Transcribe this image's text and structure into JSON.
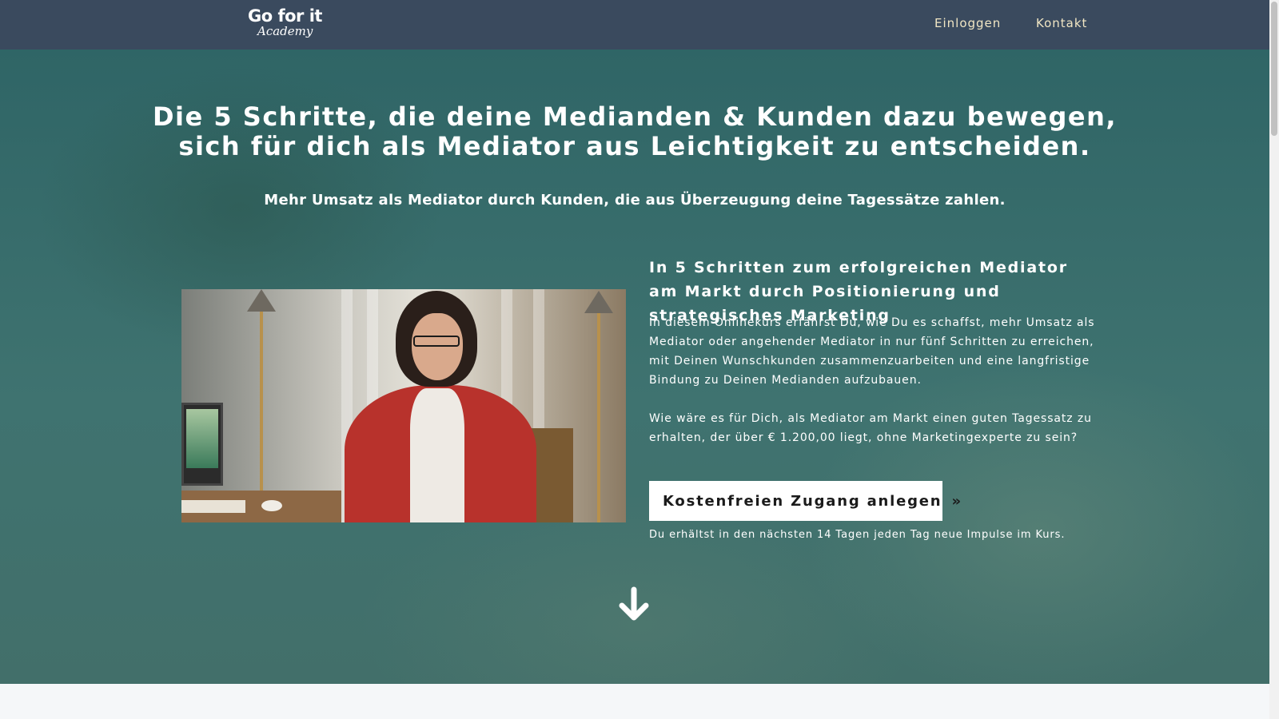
{
  "nav": {
    "logo_main": "Go for it",
    "logo_sub": "Academy",
    "links": [
      {
        "label": "Einloggen"
      },
      {
        "label": "Kontakt"
      }
    ]
  },
  "hero": {
    "headline": "Die 5 Schritte, die deine Medianden & Kunden dazu bewegen, sich für dich als Mediator aus Leichtigkeit zu entscheiden.",
    "subheadline": "Mehr Umsatz als Mediator durch Kunden, die aus Überzeugung deine Tagessätze zahlen."
  },
  "course": {
    "title": "In 5 Schritten zum erfolgreichen Mediator am Markt durch Positionierung und strategisches Marketing",
    "paragraph_1": "In diesem Onlinekurs erfährst Du, wie Du es schaffst, mehr Umsatz als Mediator oder angehender Mediator in nur fünf Schritten zu erreichen, mit Deinen Wunschkunden zusammenzuarbeiten und eine langfristige Bindung zu Deinen Medianden aufzubauen.",
    "paragraph_2": "Wie wäre es für Dich, als Mediator am Markt einen guten Tagessatz zu erhalten, der über € 1.200,00 liegt, ohne Marketingexperte zu sein?",
    "cta_label": "Kostenfreien Zugang anlegen",
    "cta_icon": "»",
    "cta_note": "Du erhältst in den nächsten 14 Tagen jeden Tag neue Impulse im Kurs."
  },
  "icons": {
    "scroll_down": "arrow-down-icon",
    "cta": "double-chevron-right-icon"
  },
  "colors": {
    "navbar": "#3a4a5e",
    "nav_link": "#f1e6c4",
    "hero_teal": "#3f7370",
    "cta_bg": "#ffffff",
    "page_bg": "#f5f7f9"
  }
}
